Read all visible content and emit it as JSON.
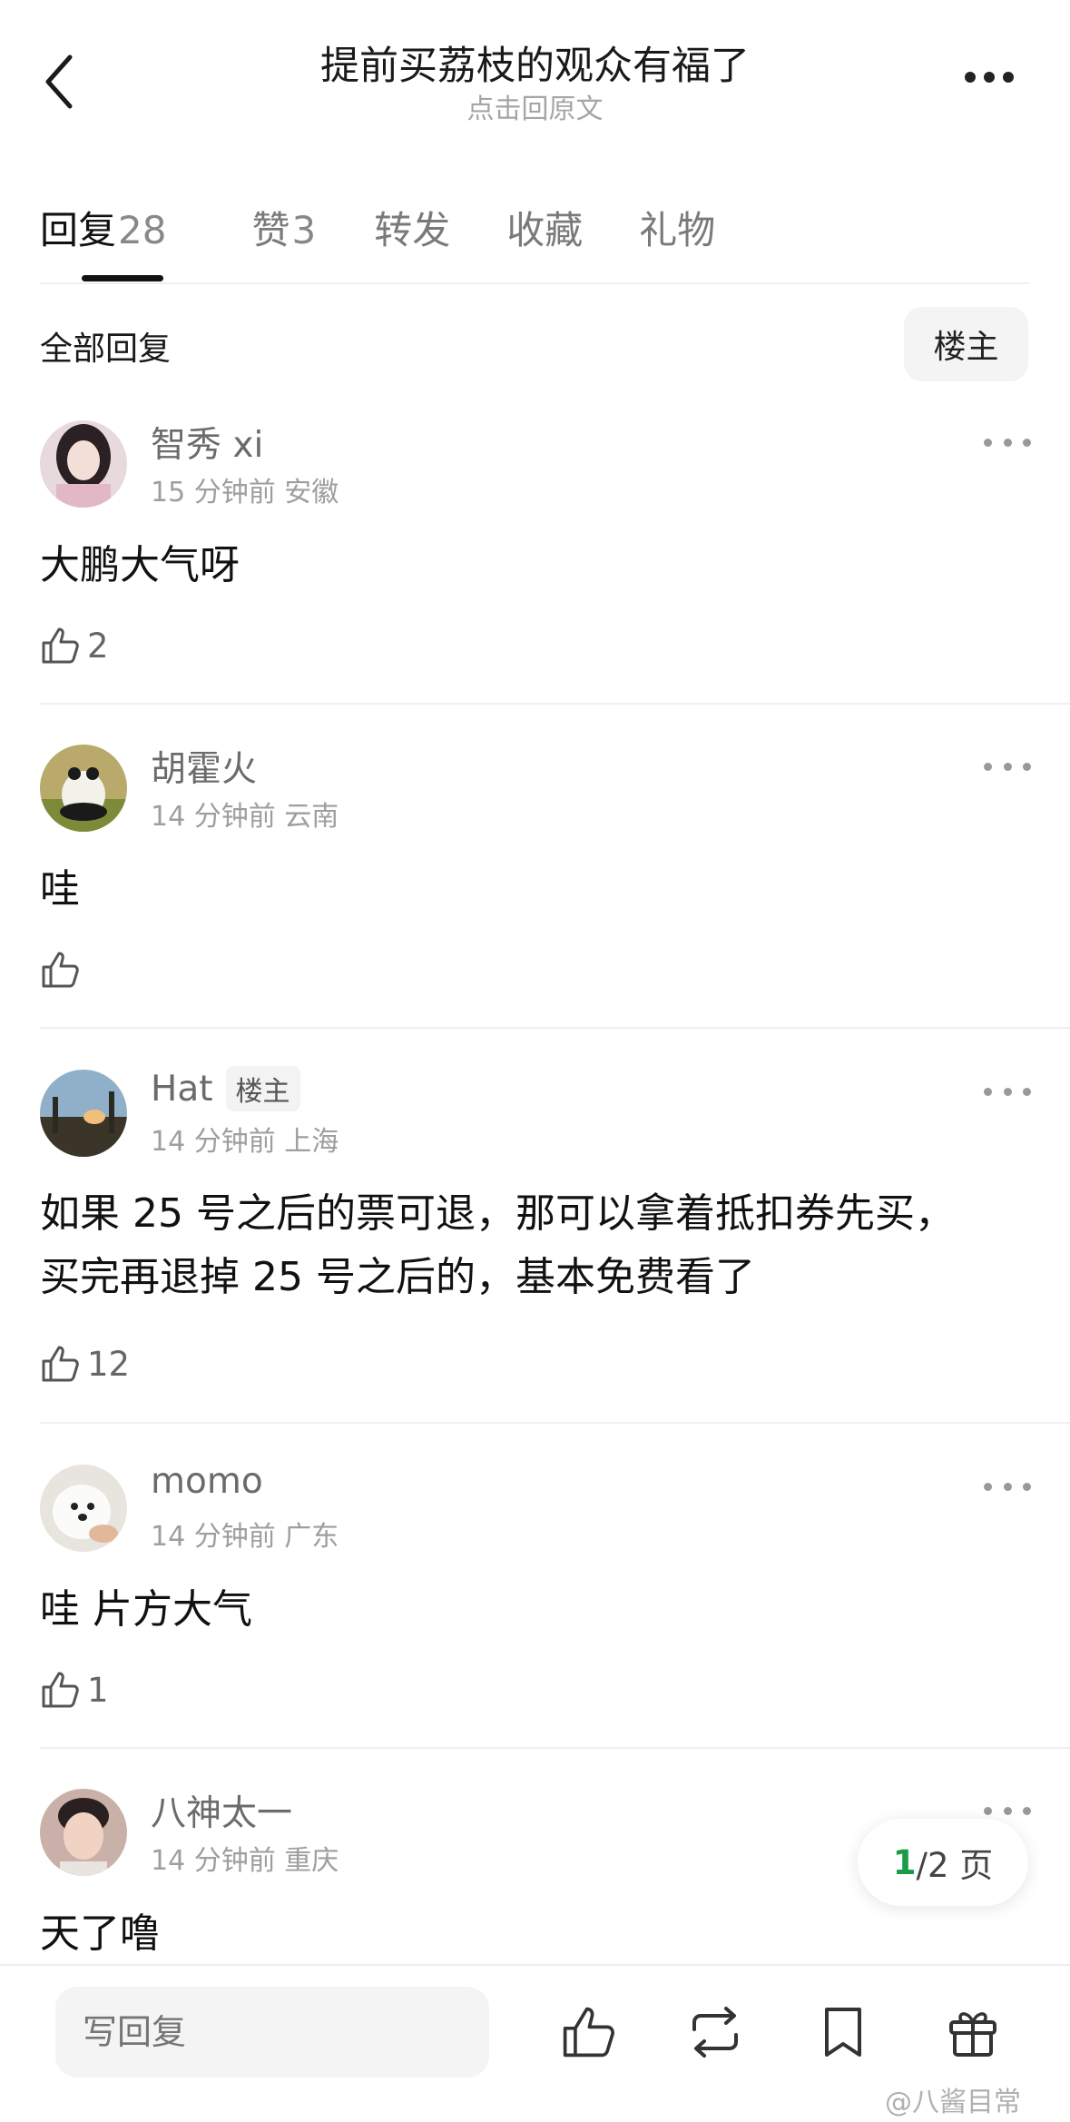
{
  "header": {
    "title": "提前买荔枝的观众有福了",
    "subtitle": "点击回原文"
  },
  "tabs": [
    {
      "label": "回复",
      "count": "28"
    },
    {
      "label": "赞",
      "count": "3"
    },
    {
      "label": "转发",
      "count": ""
    },
    {
      "label": "收藏",
      "count": ""
    },
    {
      "label": "礼物",
      "count": ""
    }
  ],
  "section": {
    "all_replies": "全部回复",
    "op_filter": "楼主"
  },
  "comments": [
    {
      "user": "智秀 xi",
      "time": "15 分钟前",
      "location": "安徽",
      "text": "大鹏大气呀",
      "likes": "2",
      "is_op": false
    },
    {
      "user": "胡霍火",
      "time": "14 分钟前",
      "location": "云南",
      "text": "哇",
      "likes": "",
      "is_op": false
    },
    {
      "user": "Hat",
      "badge": "楼主",
      "time": "14 分钟前",
      "location": "上海",
      "text_line1": "如果 25 号之后的票可退，那可以拿着抵扣券先买，",
      "text_line2": "买完再退掉 25 号之后的，基本免费看了",
      "likes": "12",
      "is_op": true
    },
    {
      "user": "momo",
      "time": "14 分钟前",
      "location": "广东",
      "text": "哇 片方大气",
      "likes": "1",
      "is_op": false
    },
    {
      "user": "八神太一",
      "time": "14 分钟前",
      "location": "重庆",
      "text": "天了噜",
      "likes": "",
      "is_op": false
    }
  ],
  "pagination": {
    "current": "1",
    "total": "/2 页"
  },
  "bottom": {
    "reply_placeholder": "写回复",
    "icons": [
      "thumbs-up-icon",
      "repost-icon",
      "bookmark-icon",
      "gift-icon"
    ]
  },
  "watermark": "@八酱目常",
  "colors": {
    "accent_green": "#1a9b45",
    "text_gray": "#9e9e9e"
  }
}
